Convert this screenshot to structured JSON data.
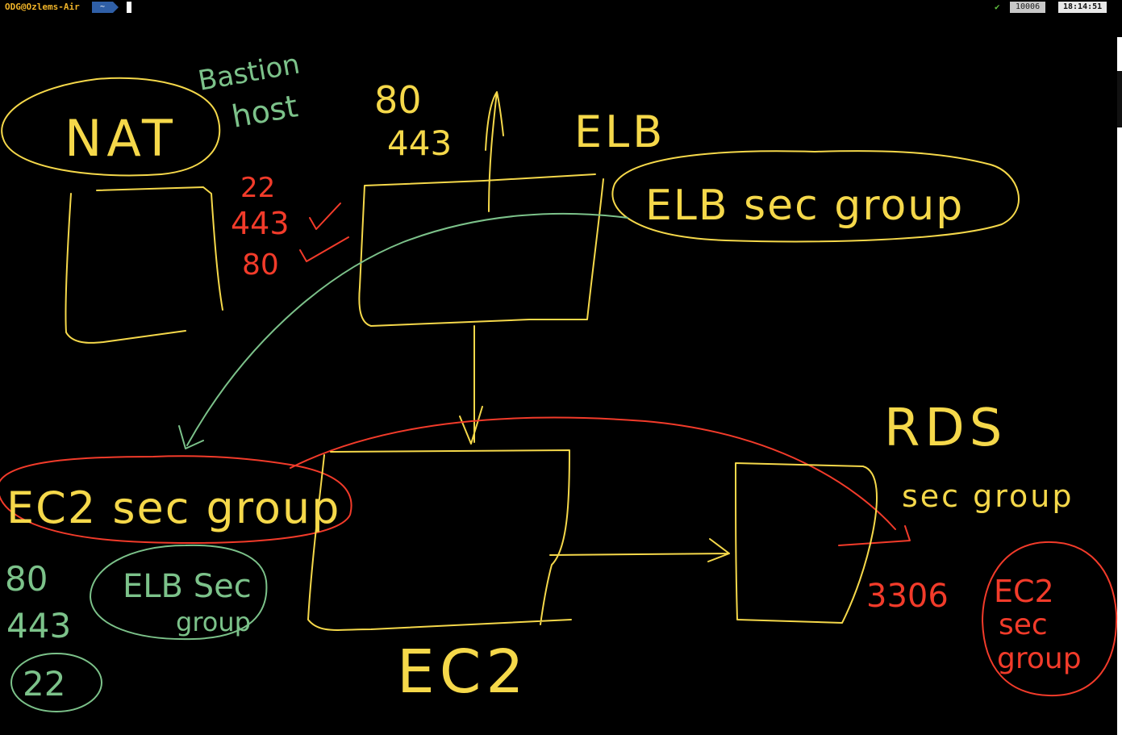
{
  "terminal": {
    "prompt_user": "ODG@Ozlems-Air",
    "directory": "~",
    "status_icon": "check-icon",
    "history_count": "10006",
    "clock": "18:14:51"
  },
  "colors": {
    "background": "#000000",
    "yellow_ink": "#f5d84a",
    "red_ink": "#f23b2a",
    "green_ink": "#7cc28a"
  },
  "drawing": {
    "nat_label": "NAT",
    "bastion_label": "Bastion host",
    "nat_ports": [
      "22",
      "443",
      "80"
    ],
    "elb_ports": [
      "80",
      "443"
    ],
    "elb_label": "ELB",
    "elb_sec_group": "ELB sec group",
    "ec2_sec_group": "EC2 sec group",
    "ec2_ports": [
      "80",
      "443",
      "22"
    ],
    "ec2_inner_group": [
      "ELB Sec",
      "group"
    ],
    "ec2_label": "EC2",
    "rds_label": "RDS",
    "rds_sec_group": "sec group",
    "rds_port": "3306",
    "rds_inner_group": [
      "EC2",
      "sec",
      "group"
    ]
  }
}
